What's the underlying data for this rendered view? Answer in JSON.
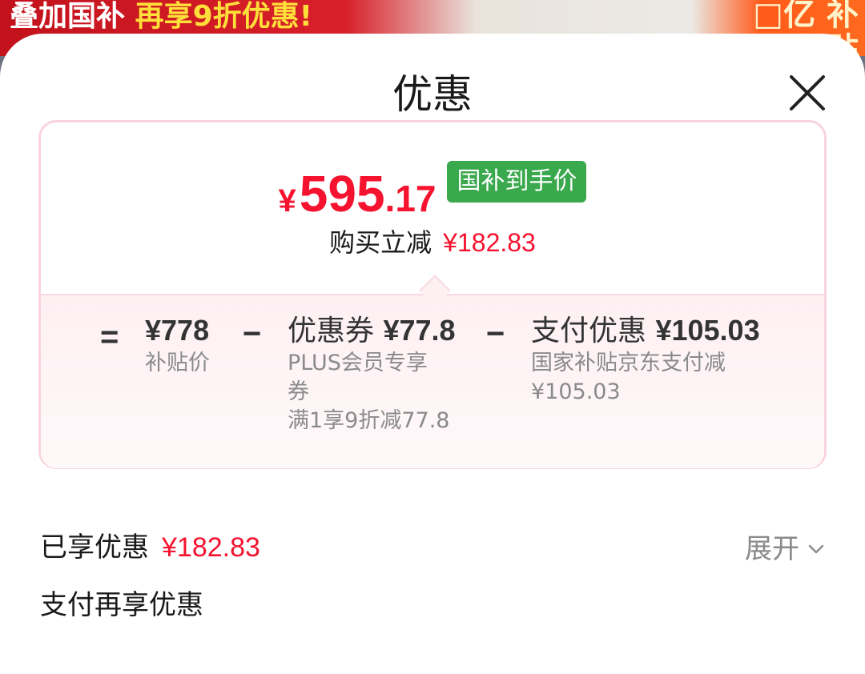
{
  "banner": {
    "text_part1": "叠加国补",
    "text_part2": "再享9折优惠!",
    "right_text": "□亿 补贴"
  },
  "sheet": {
    "title": "优惠",
    "close_icon": "close-icon"
  },
  "price_card": {
    "currency": "¥",
    "price_int": "595",
    "price_dot": ".",
    "price_dec": "17",
    "tag": "国补到手价",
    "saved_label": "购买立减",
    "saved_amount": "¥182.83"
  },
  "breakdown": {
    "eq": "=",
    "minus": "−",
    "base": {
      "amount": "¥778",
      "label": "补贴价"
    },
    "coupon": {
      "name": "优惠券",
      "amount": "¥77.8",
      "line1": "PLUS会员专享",
      "line2": "券",
      "line3": "满1享9折减77.8"
    },
    "pay": {
      "name": "支付优惠",
      "amount": "¥105.03",
      "line1": "国家补贴京东支付减",
      "line2": "¥105.03"
    }
  },
  "summary": {
    "enjoyed_label": "已享优惠",
    "enjoyed_amount": "¥182.83",
    "expand_label": "展开",
    "pay_more_label": "支付再享优惠"
  },
  "colors": {
    "accent_red": "#f5132f",
    "tag_green": "#3aa84d",
    "card_border": "#fad4dd"
  }
}
